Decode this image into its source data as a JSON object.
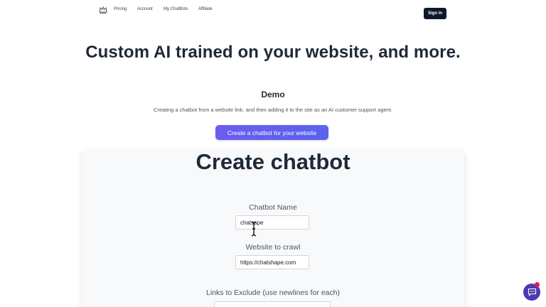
{
  "nav": {
    "links": [
      "Pricing",
      "Account",
      "My ChatBots",
      "Affiliate"
    ],
    "signin_label": "Sign in"
  },
  "hero": {
    "title": "Custom AI trained on your website, and more."
  },
  "demo": {
    "heading": "Demo",
    "description": "Creating a chatbot from a website link, and then adding it to the site as an AI customer support agent.",
    "cta_label": "Create a chatbot for your website"
  },
  "form": {
    "title": "Create chatbot",
    "chatbot_name_label": "Chatbot Name",
    "chatbot_name_value": "chatsape",
    "website_label": "Website to crawl",
    "website_value": "https://chatshape.com",
    "exclude_label": "Links to Exclude (use newlines for each)"
  },
  "colors": {
    "accent": "#5a62ee",
    "dark": "#0f172a",
    "badge": "#e11d48"
  },
  "icons": {
    "logo": "crown-icon",
    "cursor": "text-cursor-icon",
    "chat": "chat-bubble-icon"
  }
}
